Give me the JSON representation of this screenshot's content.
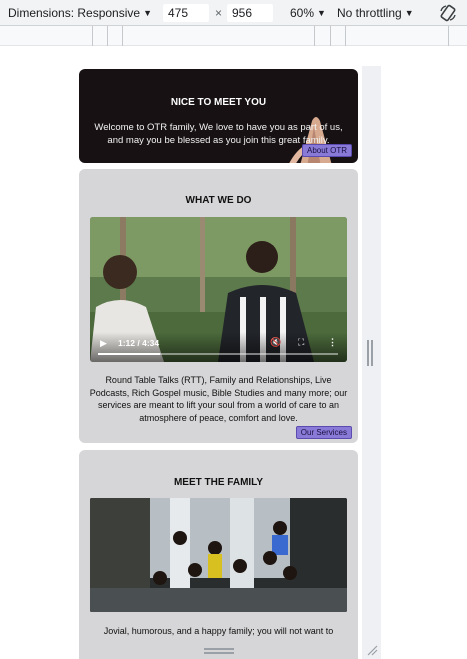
{
  "toolbar": {
    "dimensions_label": "Dimensions: Responsive",
    "width_value": "475",
    "times": "×",
    "height_value": "956",
    "zoom": "60%",
    "throttling": "No throttling",
    "rotate_icon": "rotate-icon"
  },
  "hero": {
    "title": "NICE TO MEET YOU",
    "text": "Welcome to OTR family, We love to have you as part of us, and may you be blessed as you join this great family.",
    "button": "About OTR"
  },
  "what_we_do": {
    "title": "WHAT WE DO",
    "video_time": "1:12 / 4:34",
    "video_progress": 0.26,
    "text": "Round Table Talks (RTT), Family and Relationships, Live Podcasts, Rich Gospel music, Bible Studies and many more; our services are meant to lift your soul from a world of care to an atmosphere of peace, comfort and love.",
    "button": "Our Services"
  },
  "family": {
    "title": "MEET THE FAMILY",
    "text": "Jovial, humorous, and a happy family; you will not want to"
  },
  "colors": {
    "accent_button": "#8a7ad8",
    "hero_bg": "#171114",
    "section_bg": "#d6d6d8"
  }
}
